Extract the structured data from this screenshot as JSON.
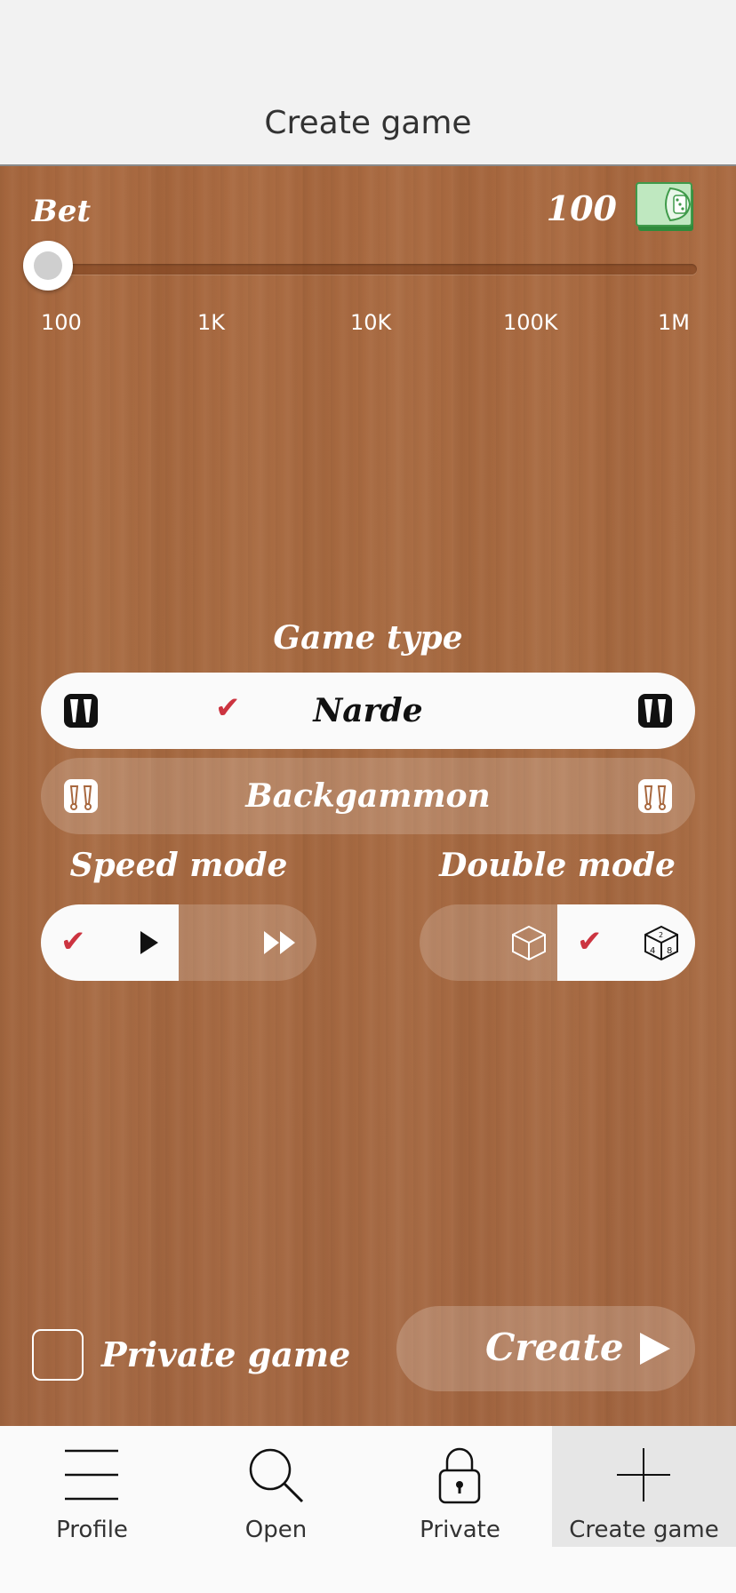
{
  "header": {
    "title": "Create game"
  },
  "bet": {
    "label": "Bet",
    "value": "100",
    "slider_fraction": 0,
    "ticks": [
      "100",
      "1K",
      "10K",
      "100K",
      "1M"
    ]
  },
  "game_type": {
    "label": "Game type",
    "options": [
      {
        "label": "Narde",
        "selected": true
      },
      {
        "label": "Backgammon",
        "selected": false
      }
    ]
  },
  "speed_mode": {
    "label": "Speed mode",
    "selected": "normal"
  },
  "double_mode": {
    "label": "Double mode",
    "selected": "doubling-cube"
  },
  "private_game": {
    "label": "Private game",
    "checked": false
  },
  "create_button": {
    "label": "Create"
  },
  "nav": {
    "items": [
      {
        "label": "Profile",
        "icon": "menu-icon"
      },
      {
        "label": "Open",
        "icon": "search-icon"
      },
      {
        "label": "Private",
        "icon": "lock-icon"
      },
      {
        "label": "Create game",
        "icon": "plus-icon",
        "active": true
      }
    ]
  },
  "colors": {
    "wood": "#a8683f",
    "check": "#cc3440",
    "money": "#3f9a4a"
  }
}
